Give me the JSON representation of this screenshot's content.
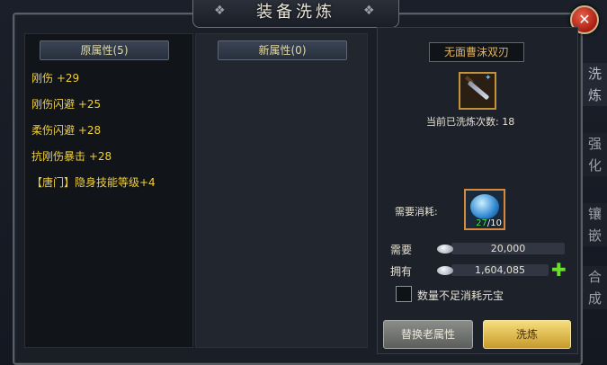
{
  "window": {
    "title": "装备洗炼"
  },
  "left_panel": {
    "header": "原属性(5)",
    "attributes": [
      "刚伤 +29",
      "刚伤闪避 +25",
      "柔伤闪避 +28",
      "抗刚伤暴击 +28",
      "【唐门】隐身技能等级+4"
    ]
  },
  "mid_panel": {
    "header": "新属性(0)"
  },
  "right_panel": {
    "weapon_name": "无面曹沫双刃",
    "wash_count": "当前已洗炼次数: 18",
    "cost_label": "需要消耗:",
    "stone_have": "27",
    "stone_need": "/10",
    "need_label": "需要",
    "need_value": "20,000",
    "own_label": "拥有",
    "own_value": "1,604,085",
    "checkbox_label": "数量不足消耗元宝",
    "replace_button": "替换老属性",
    "wash_button": "洗炼"
  },
  "side_tabs": [
    {
      "c1": "洗",
      "c2": "炼"
    },
    {
      "c1": "强",
      "c2": "化"
    },
    {
      "c1": "镶",
      "c2": "嵌"
    },
    {
      "c1": "合",
      "c2": "成"
    }
  ],
  "colors": {
    "attribute_text": "#f0cf3a",
    "weapon_name": "#e7b55c",
    "wash_button": "#d9b245",
    "plus": "#6adf2e"
  }
}
